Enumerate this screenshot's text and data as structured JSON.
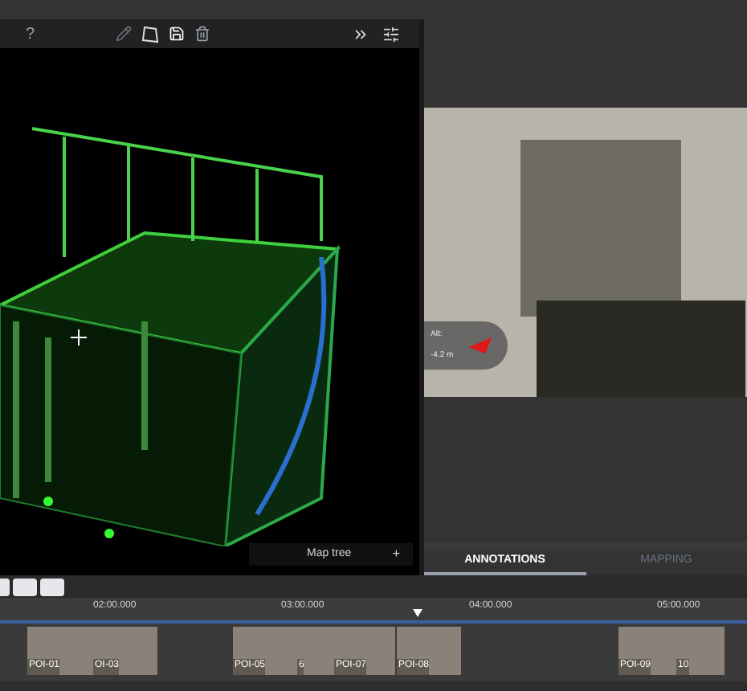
{
  "toolbar": {
    "help": "?"
  },
  "viewport": {
    "map_tree": "Map tree",
    "map_tree_add": "+"
  },
  "camera": {
    "altitude_label": "Alt:",
    "altitude_value": "-4.2 m"
  },
  "tabs": [
    {
      "label": "ANNOTATIONS",
      "selected": true
    },
    {
      "label": "MAPPING",
      "selected": false
    }
  ],
  "timeline": {
    "ticks": [
      "02:00.000",
      "03:00.000",
      "04:00.000",
      "05:00.000"
    ],
    "clips": [
      {
        "label": "POI-01"
      },
      {
        "label": "OI-03"
      },
      {
        "label": "POI-05"
      },
      {
        "label": "6"
      },
      {
        "label": "POI-07"
      },
      {
        "label": "POI-08"
      },
      {
        "label": "POI-09"
      },
      {
        "label": "10"
      }
    ]
  }
}
